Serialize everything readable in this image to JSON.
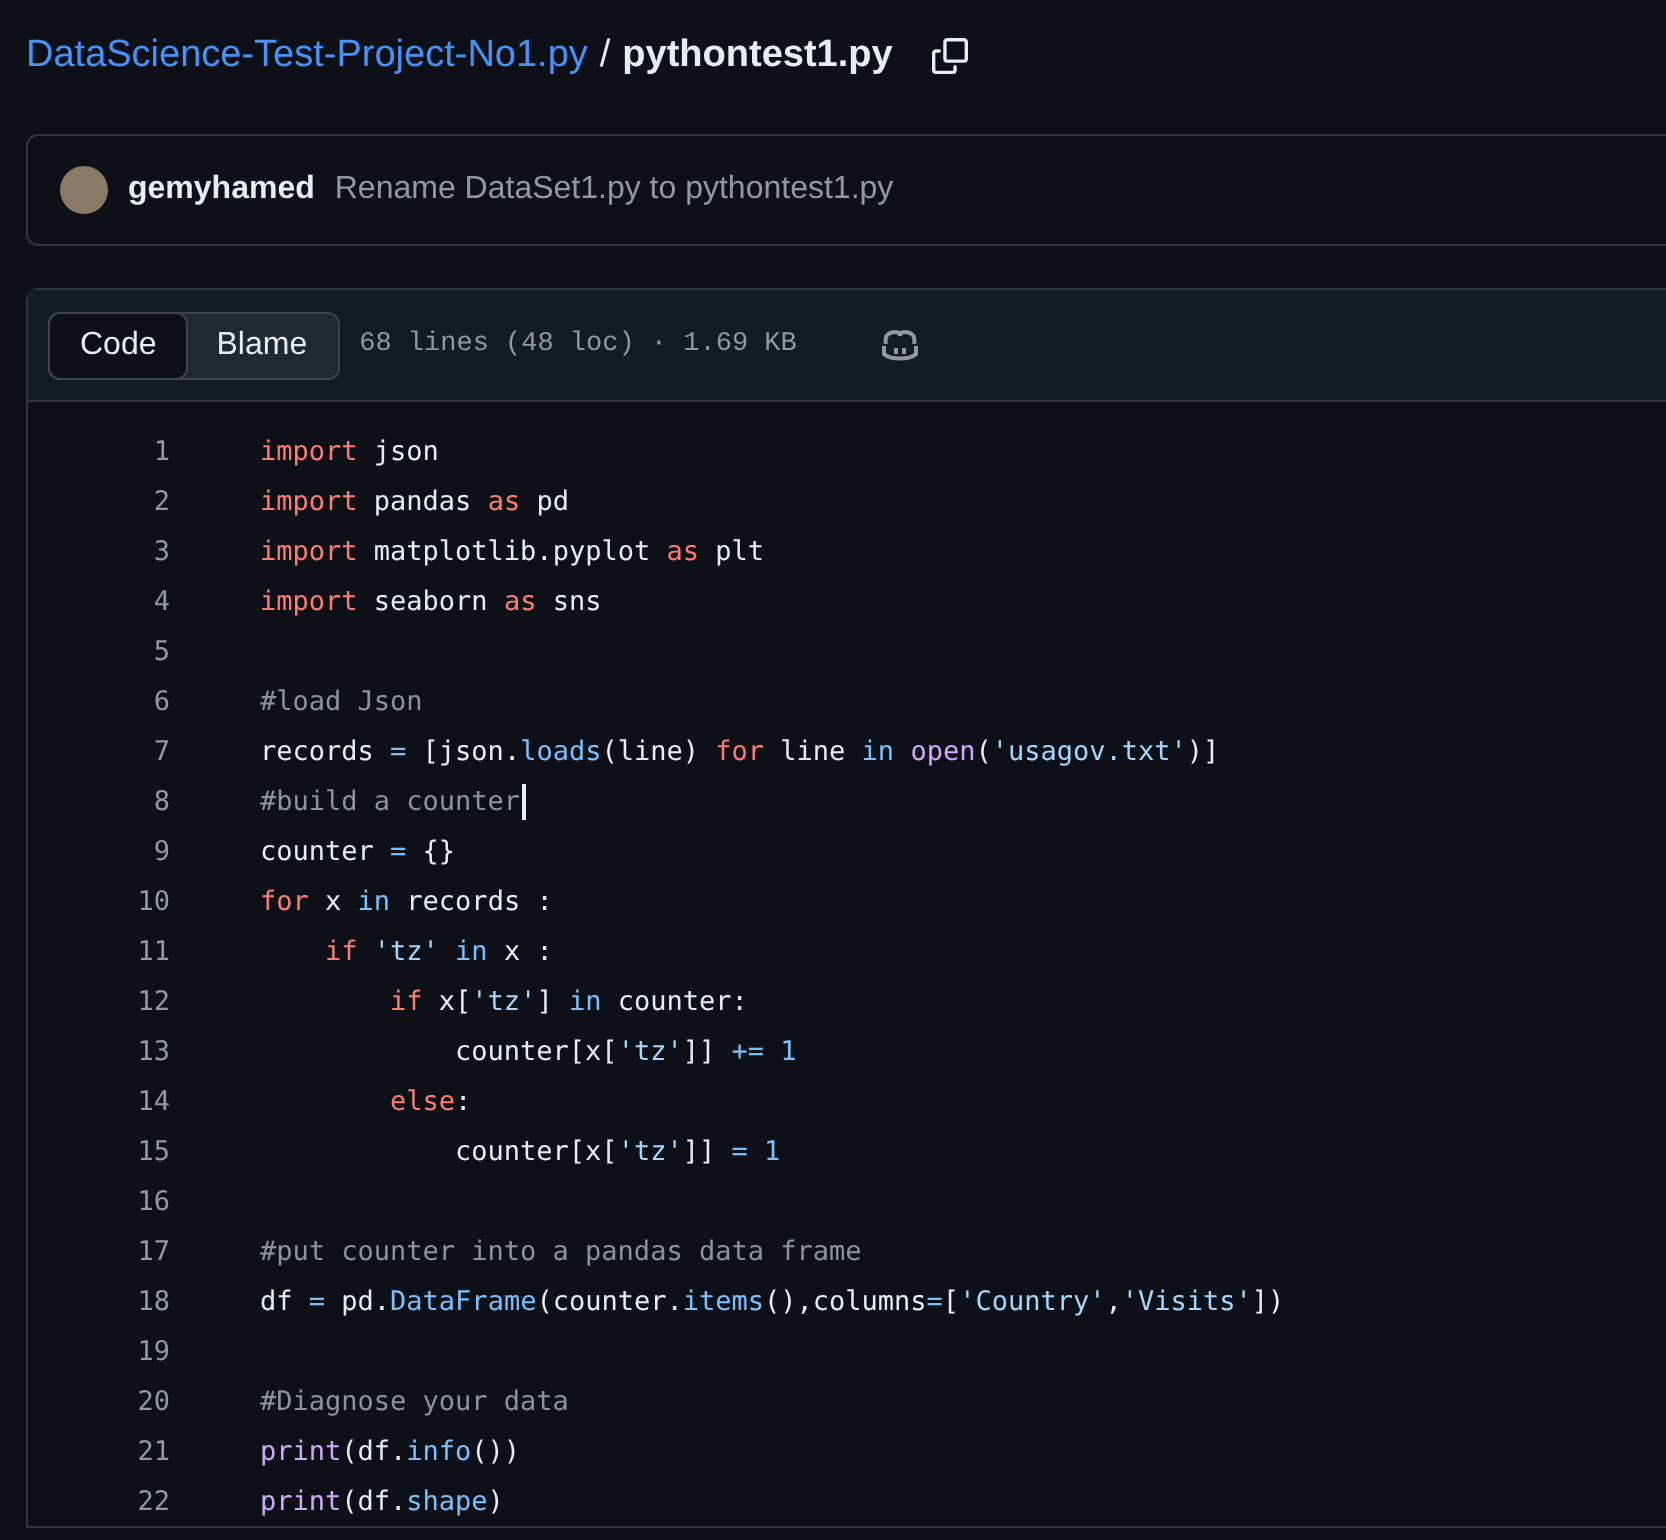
{
  "breadcrumb": {
    "repo": "DataScience-Test-Project-No1.py",
    "separator": "/",
    "file": "pythontest1.py"
  },
  "commit": {
    "author": "gemyhamed",
    "message": "Rename DataSet1.py to pythontest1.py"
  },
  "file_header": {
    "tabs": [
      {
        "label": "Code",
        "selected": true
      },
      {
        "label": "Blame",
        "selected": false
      }
    ],
    "info": "68 lines (48 loc) · 1.69 KB"
  },
  "code_lines": [
    {
      "number": "1",
      "cursor": false,
      "tokens": [
        {
          "kind": "keyword",
          "text": "import"
        },
        {
          "kind": "plain",
          "text": " json"
        }
      ]
    },
    {
      "number": "2",
      "cursor": false,
      "tokens": [
        {
          "kind": "keyword",
          "text": "import"
        },
        {
          "kind": "plain",
          "text": " pandas "
        },
        {
          "kind": "keyword",
          "text": "as"
        },
        {
          "kind": "plain",
          "text": " pd"
        }
      ]
    },
    {
      "number": "3",
      "cursor": false,
      "tokens": [
        {
          "kind": "keyword",
          "text": "import"
        },
        {
          "kind": "plain",
          "text": " matplotlib.pyplot "
        },
        {
          "kind": "keyword",
          "text": "as"
        },
        {
          "kind": "plain",
          "text": " plt"
        }
      ]
    },
    {
      "number": "4",
      "cursor": false,
      "tokens": [
        {
          "kind": "keyword",
          "text": "import"
        },
        {
          "kind": "plain",
          "text": " seaborn "
        },
        {
          "kind": "keyword",
          "text": "as"
        },
        {
          "kind": "plain",
          "text": " sns"
        }
      ]
    },
    {
      "number": "5",
      "cursor": false
    },
    {
      "number": "6",
      "cursor": false,
      "tokens": [
        {
          "kind": "comment",
          "text": "#load Json"
        }
      ]
    },
    {
      "number": "7",
      "cursor": false,
      "tokens": [
        {
          "kind": "plain",
          "text": "records "
        },
        {
          "kind": "operator",
          "text": "="
        },
        {
          "kind": "plain",
          "text": " [json."
        },
        {
          "kind": "method",
          "text": "loads"
        },
        {
          "kind": "plain",
          "text": "(line) "
        },
        {
          "kind": "keyword",
          "text": "for"
        },
        {
          "kind": "plain",
          "text": " line "
        },
        {
          "kind": "operator",
          "text": "in "
        },
        {
          "kind": "builtin",
          "text": "open"
        },
        {
          "kind": "plain",
          "text": "("
        },
        {
          "kind": "string",
          "text": "'usagov.txt'"
        },
        {
          "kind": "plain",
          "text": ")]"
        }
      ]
    },
    {
      "number": "8",
      "cursor": true,
      "tokens": [
        {
          "kind": "comment",
          "text": "#build a counter"
        }
      ]
    },
    {
      "number": "9",
      "cursor": false,
      "tokens": [
        {
          "kind": "plain",
          "text": "counter "
        },
        {
          "kind": "operator",
          "text": "="
        },
        {
          "kind": "plain",
          "text": " {}"
        }
      ]
    },
    {
      "number": "10",
      "cursor": false,
      "tokens": [
        {
          "kind": "keyword",
          "text": "for"
        },
        {
          "kind": "plain",
          "text": " x "
        },
        {
          "kind": "operator",
          "text": "in"
        },
        {
          "kind": "plain",
          "text": " records :"
        }
      ]
    },
    {
      "number": "11",
      "cursor": false,
      "tokens": [
        {
          "kind": "keyword",
          "text": "    if "
        },
        {
          "kind": "string",
          "text": "'tz'"
        },
        {
          "kind": "operator",
          "text": " in"
        },
        {
          "kind": "plain",
          "text": " x :"
        }
      ]
    },
    {
      "number": "12",
      "cursor": false,
      "tokens": [
        {
          "kind": "keyword",
          "text": "        if"
        },
        {
          "kind": "plain",
          "text": " x["
        },
        {
          "kind": "string",
          "text": "'tz'"
        },
        {
          "kind": "plain",
          "text": "] "
        },
        {
          "kind": "operator",
          "text": "in"
        },
        {
          "kind": "plain",
          "text": " counter:"
        }
      ]
    },
    {
      "number": "13",
      "cursor": false,
      "tokens": [
        {
          "kind": "plain",
          "text": "            counter[x["
        },
        {
          "kind": "string",
          "text": "'tz'"
        },
        {
          "kind": "plain",
          "text": "]] "
        },
        {
          "kind": "operator",
          "text": "+= 1"
        }
      ]
    },
    {
      "number": "14",
      "cursor": false,
      "tokens": [
        {
          "kind": "keyword",
          "text": "        else"
        },
        {
          "kind": "plain",
          "text": ":"
        }
      ]
    },
    {
      "number": "15",
      "cursor": false,
      "tokens": [
        {
          "kind": "plain",
          "text": "            counter[x["
        },
        {
          "kind": "string",
          "text": "'tz'"
        },
        {
          "kind": "plain",
          "text": "]] "
        },
        {
          "kind": "operator",
          "text": "= 1"
        }
      ]
    },
    {
      "number": "16",
      "cursor": false
    },
    {
      "number": "17",
      "cursor": false,
      "tokens": [
        {
          "kind": "comment",
          "text": "#put counter into a pandas data frame"
        }
      ]
    },
    {
      "number": "18",
      "cursor": false,
      "tokens": [
        {
          "kind": "plain",
          "text": "df "
        },
        {
          "kind": "operator",
          "text": "="
        },
        {
          "kind": "plain",
          "text": " pd."
        },
        {
          "kind": "method",
          "text": "DataFrame"
        },
        {
          "kind": "plain",
          "text": "(counter."
        },
        {
          "kind": "method",
          "text": "items"
        },
        {
          "kind": "plain",
          "text": "(),columns"
        },
        {
          "kind": "operator",
          "text": "="
        },
        {
          "kind": "plain",
          "text": "["
        },
        {
          "kind": "string",
          "text": "'Country'"
        },
        {
          "kind": "plain",
          "text": ","
        },
        {
          "kind": "string",
          "text": "'Visits'"
        },
        {
          "kind": "plain",
          "text": "])"
        }
      ]
    },
    {
      "number": "19",
      "cursor": false
    },
    {
      "number": "20",
      "cursor": false,
      "tokens": [
        {
          "kind": "comment",
          "text": "#Diagnose your data"
        }
      ]
    },
    {
      "number": "21",
      "cursor": false,
      "tokens": [
        {
          "kind": "builtin",
          "text": "print"
        },
        {
          "kind": "plain",
          "text": "(df."
        },
        {
          "kind": "method",
          "text": "info"
        },
        {
          "kind": "plain",
          "text": "())"
        }
      ]
    },
    {
      "number": "22",
      "cursor": false,
      "tokens": [
        {
          "kind": "builtin",
          "text": "print"
        },
        {
          "kind": "plain",
          "text": "(df."
        },
        {
          "kind": "method",
          "text": "shape"
        },
        {
          "kind": "plain",
          "text": ")"
        }
      ]
    }
  ]
}
